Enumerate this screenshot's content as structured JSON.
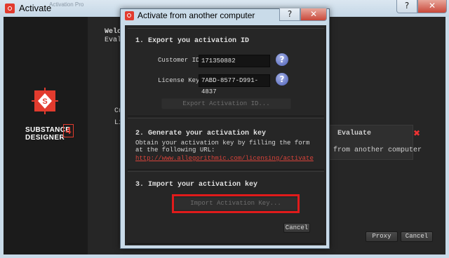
{
  "outer_window": {
    "title": "Activate",
    "behind_title": "Activation Pro",
    "help_glyph": "?",
    "close_glyph": "✕",
    "brand_line1": "SUBSTANCE",
    "brand_line2": "DESIGNER",
    "brand_version": "4",
    "frag_welcome": "Welc",
    "frag_evaluate": "Evalu",
    "frag_customer": "Cus",
    "frag_license": "Li",
    "evaluate_label": "Evaluate",
    "evaluate_close_glyph": "✖",
    "evaluate_sub": "from another computer",
    "proxy_label": "Proxy",
    "cancel_label": "Cancel"
  },
  "modal": {
    "title": "Activate from another computer",
    "help_glyph": "?",
    "close_glyph": "✕",
    "section1": {
      "heading": "1. Export you activation ID",
      "customer_id_label": "Customer ID:",
      "customer_id_value": "171350882",
      "license_key_label": "License Key:",
      "license_key_value": "7ABD-8577-D991-4837",
      "help_glyph": "?",
      "export_button": "Export Activation ID..."
    },
    "section2": {
      "heading": "2. Generate your activation key",
      "instructions": "Obtain your activation key by filling the form at the following URL:",
      "link": "http://www.allegorithmic.com/licensing/activate"
    },
    "section3": {
      "heading": "3. Import your activation key",
      "import_button": "Import Activation Key..."
    },
    "cancel_label": "Cancel"
  },
  "colors": {
    "accent": "#e23b2e",
    "highlight": "#e01b1b",
    "link": "#d9433a"
  }
}
